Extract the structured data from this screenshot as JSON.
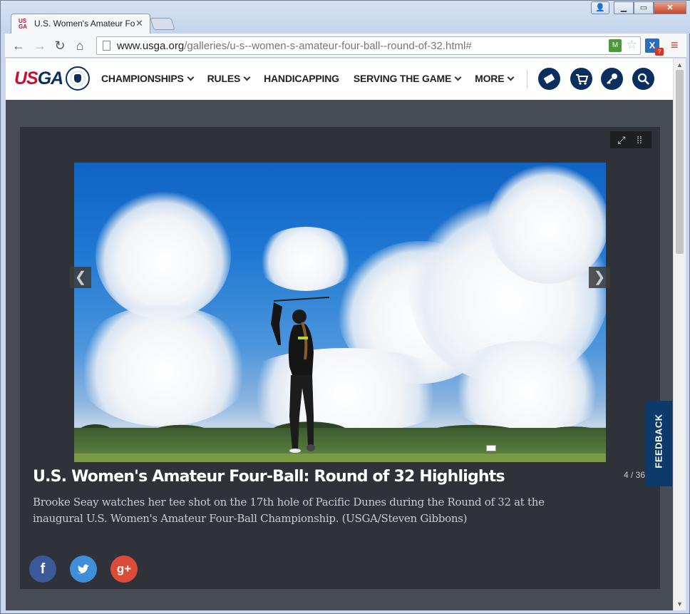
{
  "browser": {
    "tab_title": "U.S. Women's Amateur Fo",
    "tab_favicon": "USGA",
    "url_host": "www.usga.org",
    "url_path": "/galleries/u-s--women-s-amateur-four-ball--round-of-32.html#",
    "window_controls": [
      "user-icon",
      "minimize-icon",
      "maximize-icon",
      "close-icon"
    ],
    "close_glyph": "✕",
    "back_glyph": "←",
    "forward_glyph": "→",
    "reload_glyph": "↻",
    "home_glyph": "⌂",
    "menu_glyph": "≡",
    "star_glyph": "☆",
    "ext_badge": "?",
    "accent_color": "#c9d8ef"
  },
  "site": {
    "logo": "USGA",
    "nav": [
      {
        "label": "CHAMPIONSHIPS",
        "has_dropdown": true
      },
      {
        "label": "RULES",
        "has_dropdown": true
      },
      {
        "label": "HANDICAPPING",
        "has_dropdown": false
      },
      {
        "label": "SERVING THE GAME",
        "has_dropdown": true
      },
      {
        "label": "MORE",
        "has_dropdown": true
      }
    ],
    "icons": [
      "ticket-icon",
      "cart-icon",
      "key-icon",
      "search-icon"
    ],
    "brand_color": "#0a2f5e",
    "brand_red": "#c8102e"
  },
  "gallery": {
    "title": "U.S. Women's Amateur Four-Ball: Round of 32 Highlights",
    "counter": "4 / 36",
    "caption": "Brooke Seay watches her tee shot on the 17th hole of Pacific Dunes during the Round of 32 at the inaugural U.S. Women's Amateur Four-Ball Championship. (USGA/Steven Gibbons)",
    "prev_glyph": "❮",
    "next_glyph": "❯",
    "share": {
      "facebook": "f",
      "twitter": "🐦",
      "googleplus": "g+"
    },
    "tools": [
      "fullscreen-icon",
      "grid-icon"
    ]
  },
  "feedback": {
    "label": "FEEDBACK"
  }
}
